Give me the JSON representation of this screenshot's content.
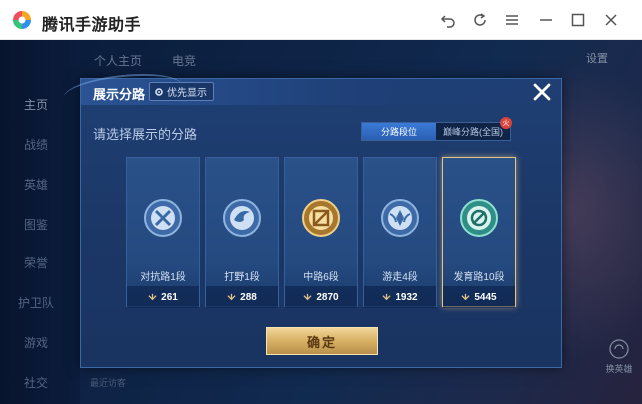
{
  "window": {
    "title": "腾讯手游助手",
    "controls": [
      "back-icon",
      "refresh-icon",
      "menu-icon",
      "minimize-icon",
      "maximize-icon",
      "close-icon"
    ]
  },
  "background": {
    "nav_items": [
      "主页",
      "战绩",
      "英雄",
      "图鉴",
      "荣誉",
      "护卫队",
      "游戏",
      "社交"
    ],
    "top_tabs": [
      "个人主页",
      "电竞"
    ],
    "settings": "设置",
    "bottom_hint": "最近访客",
    "bottom_right_label": "换英雄"
  },
  "modal": {
    "title": "展示分路",
    "priority_badge": "优先显示",
    "subtitle": "请选择展示的分路",
    "toggle": {
      "active": "分路段位",
      "inactive": "巅峰分路(全国)"
    },
    "cards": [
      {
        "name": "对抗路1段",
        "value": "261",
        "emblem": "shield-sword-icon",
        "selected": false
      },
      {
        "name": "打野1段",
        "value": "288",
        "emblem": "wing-icon",
        "selected": false
      },
      {
        "name": "中路6段",
        "value": "2870",
        "emblem": "staff-icon",
        "selected": false
      },
      {
        "name": "游走4段",
        "value": "1932",
        "emblem": "wings-crest-icon",
        "selected": false
      },
      {
        "name": "发育路10段",
        "value": "5445",
        "emblem": "target-icon",
        "selected": true
      }
    ],
    "confirm": "确定"
  },
  "colors": {
    "accent_gold": "#e4c588",
    "modal_bg": "#1f3f74",
    "toggle_active": "#3b7ad6"
  }
}
